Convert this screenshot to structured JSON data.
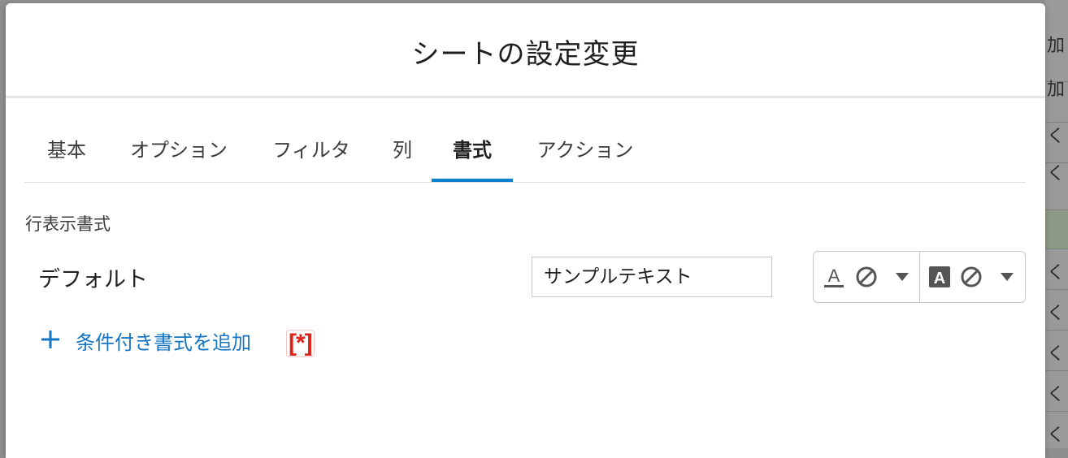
{
  "background": {
    "right_texts": [
      "加",
      "加",
      "く",
      "く",
      "く",
      "く",
      "く",
      "く",
      "く",
      "く"
    ]
  },
  "modal": {
    "title": "シートの設定変更",
    "tabs": [
      {
        "label": "基本"
      },
      {
        "label": "オプション"
      },
      {
        "label": "フィルタ"
      },
      {
        "label": "列"
      },
      {
        "label": "書式",
        "active": true
      },
      {
        "label": "アクション"
      }
    ],
    "section_label": "行表示書式",
    "default_row": {
      "label": "デフォルト",
      "sample_text": "サンプルテキスト"
    },
    "add_conditional_label": "条件付き書式を追加",
    "asterisk_badge": "[*]"
  },
  "colors": {
    "accent": "#0d7fd1",
    "link": "#1675c2",
    "badge": "#e0211a"
  },
  "icons": [
    "text-color-icon",
    "no-color-icon",
    "dropdown-arrow-icon",
    "background-color-icon",
    "plus-icon"
  ]
}
